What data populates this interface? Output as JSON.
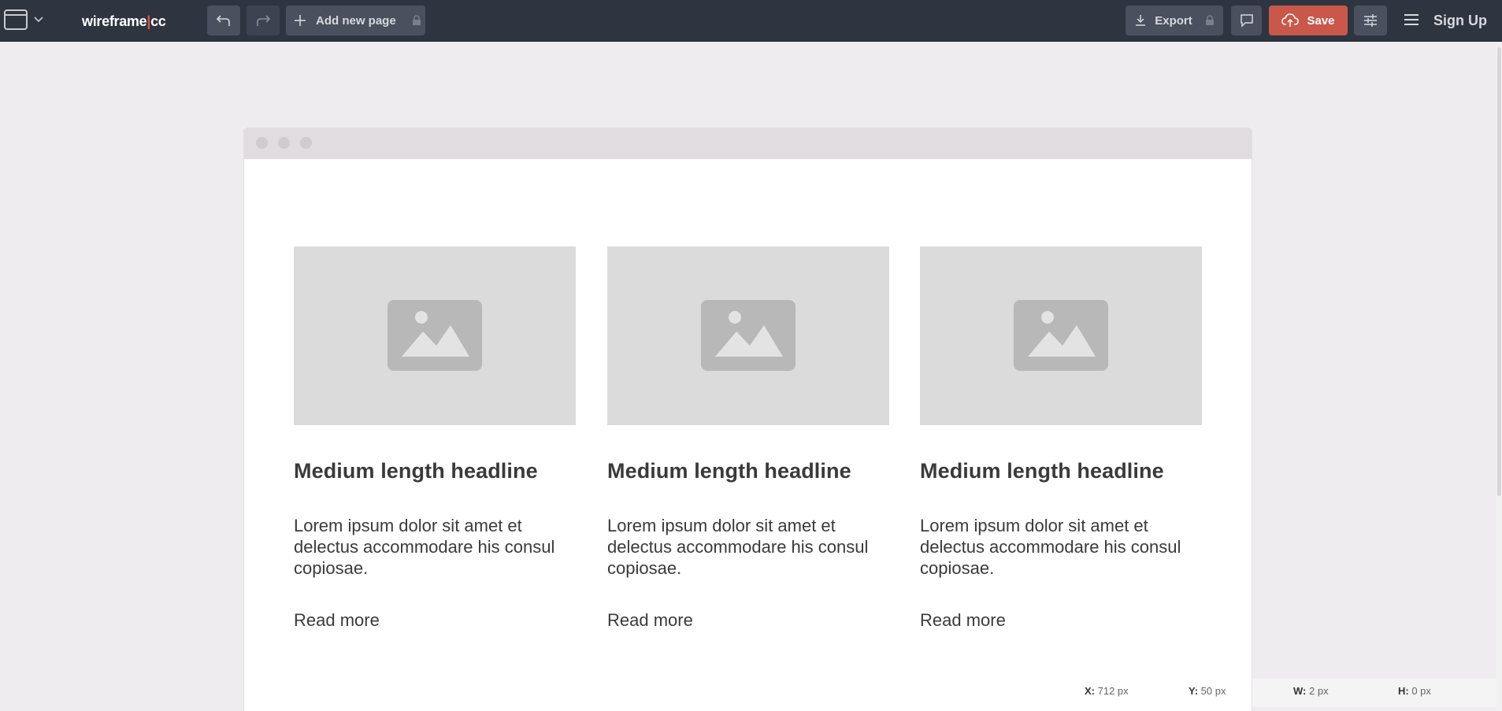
{
  "toolbar": {
    "logo_main": "wireframe",
    "logo_sep": "|",
    "logo_suffix": "cc",
    "add_page_label": "Add new page",
    "export_label": "Export",
    "save_label": "Save",
    "signup_label": "Sign Up",
    "accent_color": "#c9584a"
  },
  "cards": [
    {
      "headline": "Medium length headline",
      "body": "Lorem ipsum dolor sit amet et delectus accommodare his consul copiosae.",
      "link": "Read more"
    },
    {
      "headline": "Medium length headline",
      "body": "Lorem ipsum dolor sit amet et delectus accommodare his consul copiosae.",
      "link": "Read more"
    },
    {
      "headline": "Medium length headline",
      "body": "Lorem ipsum dolor sit amet et delectus accommodare his consul copiosae.",
      "link": "Read more"
    }
  ],
  "status": {
    "x_label": "X:",
    "x_value": "712 px",
    "y_label": "Y:",
    "y_value": "50 px",
    "w_label": "W:",
    "w_value": "2 px",
    "h_label": "H:",
    "h_value": "0 px"
  }
}
